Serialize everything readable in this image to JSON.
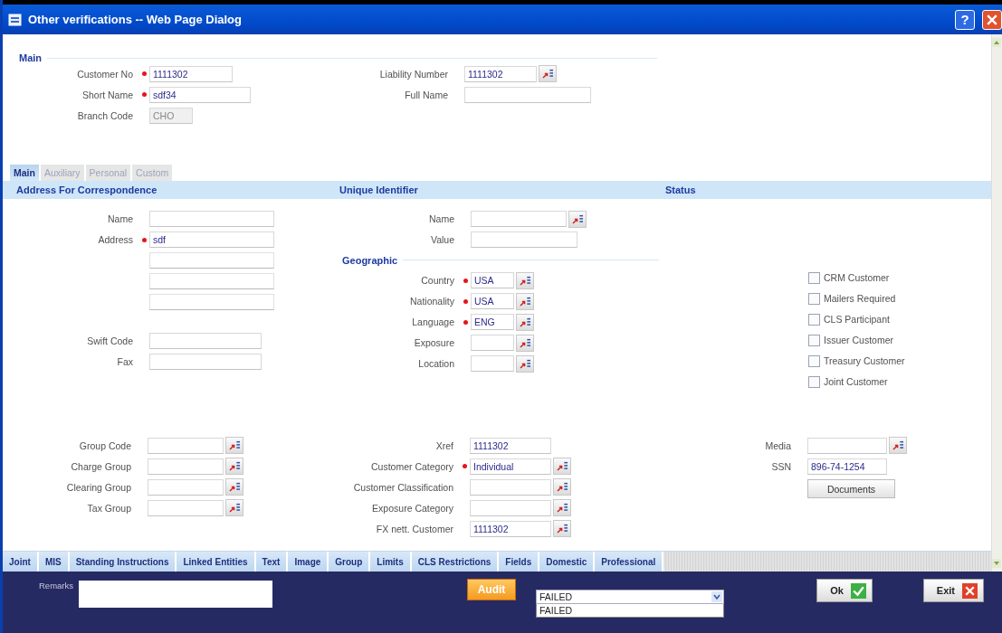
{
  "window": {
    "title": "Other verifications -- Web Page Dialog",
    "help_button": "?"
  },
  "header": {
    "heading": "Main",
    "columns": [
      {
        "fields": [
          {
            "label": "Customer No",
            "kind": "text",
            "required": true,
            "value": "1111302"
          },
          {
            "label": "Short Name",
            "kind": "text",
            "required": true,
            "value": "sdf34"
          },
          {
            "label": "Branch Code",
            "kind": "readonly",
            "required": false,
            "value": "CHO"
          }
        ]
      },
      {
        "fields": [
          {
            "label": "Liability Number",
            "kind": "lookup",
            "required": false,
            "value": "1111302"
          },
          {
            "label": "Full Name",
            "kind": "text",
            "required": false
          }
        ]
      }
    ]
  },
  "tabs": [
    {
      "label": "Main",
      "selected": true
    },
    {
      "label": "Auxiliary",
      "selected": false
    },
    {
      "label": "Personal",
      "selected": false
    },
    {
      "label": "Custom",
      "selected": false
    }
  ],
  "address": {
    "heading": "Address For Correspondence",
    "fields": [
      {
        "label": "Name",
        "kind": "text",
        "required": false
      },
      {
        "label": "Address",
        "kind": "text",
        "required": true,
        "value": "sdf"
      },
      {
        "kind": "line",
        "required": false
      },
      {
        "kind": "line",
        "required": false
      },
      {
        "kind": "line",
        "required": false
      }
    ],
    "contact_fields": [
      {
        "label": "Swift Code",
        "kind": "text",
        "required": false
      },
      {
        "label": "Fax",
        "kind": "text",
        "required": false
      }
    ]
  },
  "unique_identifier": {
    "heading": "Unique Identifier",
    "fields": [
      {
        "label": "Name",
        "kind": "lookup",
        "required": false
      },
      {
        "label": "Value",
        "kind": "text",
        "required": false
      }
    ]
  },
  "geographic": {
    "heading": "Geographic",
    "fields": [
      {
        "label": "Country",
        "kind": "lookup",
        "required": true,
        "value": "USA"
      },
      {
        "label": "Nationality",
        "kind": "lookup",
        "required": true,
        "value": "USA"
      },
      {
        "label": "Language",
        "kind": "lookup",
        "required": true,
        "value": "ENG"
      },
      {
        "label": "Exposure",
        "kind": "lookup",
        "required": false
      },
      {
        "label": "Location",
        "kind": "lookup",
        "required": false
      }
    ]
  },
  "status": {
    "heading": "Status",
    "checkboxes": [
      {
        "label": "CRM Customer",
        "checked": false
      },
      {
        "label": "Mailers Required",
        "checked": false
      },
      {
        "label": "CLS Participant",
        "checked": false
      },
      {
        "label": "Issuer Customer",
        "checked": false
      },
      {
        "label": "Treasury Customer",
        "checked": false
      },
      {
        "label": "Joint Customer",
        "checked": false
      }
    ]
  },
  "details": {
    "columns": [
      {
        "fields": [
          {
            "label": "Group Code",
            "kind": "lookup",
            "required": false
          },
          {
            "label": "Charge Group",
            "kind": "lookup",
            "required": false
          },
          {
            "label": "Clearing Group",
            "kind": "lookup",
            "required": false
          },
          {
            "label": "Tax Group",
            "kind": "lookup",
            "required": false
          }
        ]
      },
      {
        "fields": [
          {
            "label": "Xref",
            "kind": "text",
            "required": false,
            "value": "1111302"
          },
          {
            "label": "Customer Category",
            "kind": "lookup",
            "required": true,
            "value": "Individual"
          },
          {
            "label": "Customer Classification",
            "kind": "lookup",
            "required": false
          },
          {
            "label": "Exposure Category",
            "kind": "lookup",
            "required": false
          },
          {
            "label": "FX nett. Customer",
            "kind": "lookup",
            "required": false,
            "value": "1111302"
          }
        ]
      },
      {
        "fields": [
          {
            "label": "Media",
            "kind": "lookup",
            "required": false
          },
          {
            "label": "SSN",
            "kind": "text",
            "required": false,
            "value": "896-74-1254"
          }
        ]
      }
    ],
    "documents_button": "Documents"
  },
  "bottom_tabs": [
    "Joint",
    "MIS",
    "Standing Instructions",
    "Linked Entities",
    "Text",
    "Image",
    "Group",
    "Limits",
    "CLS Restrictions",
    "Fields",
    "Domestic",
    "Professional"
  ],
  "footer": {
    "remarks_label": "Remarks",
    "audit_button": "Audit",
    "status_select": {
      "value": "FAILED",
      "expanded": true,
      "options": [
        "FAILED"
      ]
    },
    "ok_button": "Ok",
    "exit_button": "Exit"
  }
}
